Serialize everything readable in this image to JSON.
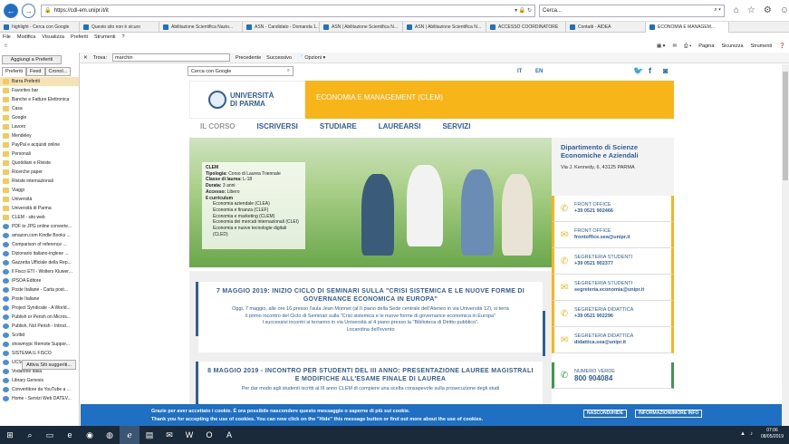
{
  "browser": {
    "url": "https://cdl-em.unipr.it/it",
    "search_placeholder": "Cerca...",
    "tabs": [
      {
        "label": "highlight - Cerca con Google",
        "active": false
      },
      {
        "label": "Questo sito non è sicuro",
        "active": false
      },
      {
        "label": "Abilitazione Scientifica Nazio...",
        "active": false
      },
      {
        "label": "ASN - Candidato - Domanda 1...",
        "active": false
      },
      {
        "label": "ASN | Abilitazione Scientifica N...",
        "active": false
      },
      {
        "label": "ASN | Abilitazione Scientifica N...",
        "active": false
      },
      {
        "label": "ACCESSO COORDINATORE",
        "active": false
      },
      {
        "label": "Contatti - AIDEA",
        "active": false
      },
      {
        "label": "ECONOMIA E MANAGEM...",
        "active": true
      }
    ],
    "menu": [
      "File",
      "Modifica",
      "Visualizza",
      "Preferiti",
      "Strumenti",
      "?"
    ],
    "command_bar": {
      "page": "Pagina",
      "security": "Sicurezza",
      "tools": "Strumenti"
    }
  },
  "favorites": {
    "add_button": "Aggiungi a Preferiti",
    "tabs": [
      "Preferiti",
      "Feed",
      "Cronol..."
    ],
    "items": [
      {
        "label": "Barra Preferiti",
        "type": "folder",
        "selected": true
      },
      {
        "label": "Favorites bar",
        "type": "folder"
      },
      {
        "label": "Banche e Fatture Elettronica",
        "type": "folder"
      },
      {
        "label": "Casa",
        "type": "folder"
      },
      {
        "label": "Google",
        "type": "folder"
      },
      {
        "label": "Lavoro",
        "type": "folder"
      },
      {
        "label": "Mendeley",
        "type": "folder"
      },
      {
        "label": "PayPal e acquisti online",
        "type": "folder"
      },
      {
        "label": "Personali",
        "type": "folder"
      },
      {
        "label": "Quotidiani e Riviste",
        "type": "folder"
      },
      {
        "label": "Ricerche paper",
        "type": "folder"
      },
      {
        "label": "Riviste internazionali",
        "type": "folder"
      },
      {
        "label": "Viaggi",
        "type": "folder"
      },
      {
        "label": "Università",
        "type": "folder"
      },
      {
        "label": "Università di Parma",
        "type": "folder"
      },
      {
        "label": "CLEM - sito web",
        "type": "folder"
      },
      {
        "label": "PDF to JPG online converte...",
        "type": "site"
      },
      {
        "label": "amazon.com Kindle Books ...",
        "type": "site"
      },
      {
        "label": "Comparison of reference ...",
        "type": "site"
      },
      {
        "label": "Dizionario italiano-inglese ...",
        "type": "site"
      },
      {
        "label": "Gazzetta Ufficiale della Rep...",
        "type": "site"
      },
      {
        "label": "Il Fisco ETI - Wolters Kluwer...",
        "type": "site"
      },
      {
        "label": "IPSOA Editore",
        "type": "site"
      },
      {
        "label": "Poste Italiane - Carta post...",
        "type": "site"
      },
      {
        "label": "Poste Italiane",
        "type": "site"
      },
      {
        "label": "Project Syndicate - A World...",
        "type": "site"
      },
      {
        "label": "Publish or Perish on Micros...",
        "type": "site"
      },
      {
        "label": "Publish, Not Perish - Introd...",
        "type": "site"
      },
      {
        "label": "Scribd",
        "type": "site"
      },
      {
        "label": "showmypc Remote Suppor...",
        "type": "site"
      },
      {
        "label": "SISTEMA IL FISCO",
        "type": "site"
      },
      {
        "label": "UCSC - Sistema di Autentic...",
        "type": "site"
      },
      {
        "label": "Vodafone Italia",
        "type": "site"
      },
      {
        "label": "Library Genesis",
        "type": "site"
      },
      {
        "label": "Convertitore da YouTube a ...",
        "type": "site"
      },
      {
        "label": "Home - Servizi Web DATEV...",
        "type": "site"
      }
    ],
    "sync_button": "Attiva Siti suggeriti..."
  },
  "findbar": {
    "label": "Trova:",
    "value": "marchin",
    "prev": "Precedente",
    "next": "Successivo",
    "options": "Opzioni"
  },
  "site": {
    "search_placeholder": "Cerca con Google",
    "lang_it": "IT",
    "lang_en": "EN",
    "logo_line1": "UNIVERSITÀ",
    "logo_line2": "DI PARMA",
    "banner_title": "ECONOMIA E MANAGEMENT (CLEM)",
    "nav": [
      "IL CORSO",
      "ISCRIVERSI",
      "STUDIARE",
      "LAUREARSI",
      "SERVIZI"
    ],
    "course_card": {
      "name": "CLEM",
      "type_label": "Tipologia:",
      "type_value": "Corso di Laurea Triennale",
      "class_label": "Classe di laurea:",
      "class_value": "L-18",
      "duration_label": "Durata:",
      "duration_value": "3 anni",
      "access_label": "Accesso:",
      "access_value": "Libero",
      "curricula_title": "6 curriculum",
      "curricula": [
        "Economia aziendale (CLEA)",
        "Economia e finanza (CLEF)",
        "Economia e marketing (CLEM)",
        "Economia dei mercati internazionali (CLEI)",
        "Economia e nuove tecnologie digitali (CLED)"
      ]
    },
    "dept": {
      "title": "Dipartimento di Scienze Economiche e Aziendali",
      "address": "Via J. Kennedy, 6, 43125 PARMA"
    },
    "contacts": [
      {
        "label": "FRONT OFFICE",
        "value": "+39 0521 902466",
        "icon": "phone-icon"
      },
      {
        "label": "FRONT OFFICE",
        "value": "frontoffice.sea@unipr.it",
        "icon": "mail-icon"
      },
      {
        "label": "SEGRETERIA STUDENTI",
        "value": "+39 0521 902377",
        "icon": "phone-icon"
      },
      {
        "label": "SEGRETERIA STUDENTI",
        "value": "segreteria.economia@unipr.it",
        "icon": "mail-icon"
      },
      {
        "label": "SEGRETERIA DIDATTICA",
        "value": "+39 0521 902296",
        "icon": "phone-icon"
      },
      {
        "label": "SEGRETERIA DIDATTICA",
        "value": "didattica.sea@unipr.it",
        "icon": "mail-icon"
      },
      {
        "label": "NUMERO VERDE",
        "value": "800 904084",
        "icon": "phone-icon"
      }
    ],
    "news": [
      {
        "title": "7 MAGGIO 2019: INIZIO CICLO DI SEMINARI SULLA \"CRISI SISTEMICA E LE NUOVE FORME DI GOVERNANCE ECONOMICA IN EUROPA\"",
        "line1": "Oggi, 7 maggio, alle ore 16 presso l'aula Jean Monnet (al II piano della Sede centrale dell'Ateneo in via Università 12), si terrà",
        "line2": "il primo incontro del Ciclo di Seminari sulla \"Crisi sistemica e le nuove forme di governance economica in Europa\"",
        "line3": "I successivi incontri si terranno in via Università al 4 piano presso la \"Biblioteca di Diritto pubblico\".",
        "line4": "Locandina dell'evento"
      },
      {
        "title": "8 MAGGIO 2019 - INCONTRO PER STUDENTI DEL III ANNO: PRESENTAZIONE LAUREE MAGISTRALI E MODIFICHE ALL'ESAME FINALE DI LAUREA",
        "line1": "Per dar modo agli studenti iscritti al III anno CLEM di compiere una scelta consapevole sulla prosecuzione degli studi"
      }
    ],
    "cookie": {
      "line1": "Grazie per aver accettato i cookie. È ora possibile nascondere questo messaggio o saperne di più sui cookie.",
      "line2": "Thank you for accepting the use of cookies. You can now click on the \"Hide\" this message button or find out more about the use of cookies.",
      "hide": "NASCONDI/HIDE",
      "info": "INFORMAZIONI/MORE INFO"
    }
  },
  "taskbar": {
    "time": "07:06",
    "date": "08/05/2019"
  },
  "colors": {
    "brand_blue": "#2f5e9e",
    "accent_yellow": "#f7b51a",
    "green": "#3a9b4a",
    "cookie_blue": "#1f6fc5"
  }
}
